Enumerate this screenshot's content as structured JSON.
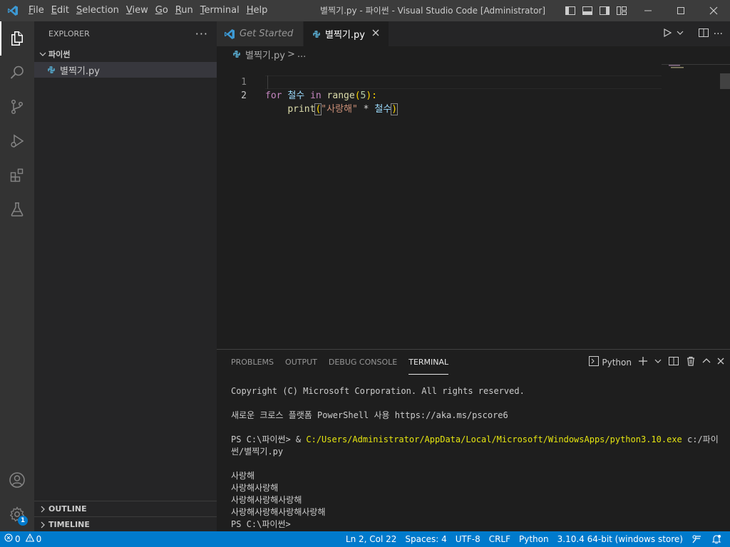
{
  "window": {
    "title": "별찍기.py - 파이썬 - Visual Studio Code [Administrator]",
    "menu": [
      {
        "mn": "F",
        "rest": "ile"
      },
      {
        "mn": "E",
        "rest": "dit"
      },
      {
        "mn": "S",
        "rest": "election"
      },
      {
        "mn": "V",
        "rest": "iew"
      },
      {
        "mn": "G",
        "rest": "o"
      },
      {
        "mn": "R",
        "rest": "un"
      },
      {
        "mn": "T",
        "rest": "erminal"
      },
      {
        "mn": "H",
        "rest": "elp"
      }
    ]
  },
  "sidebar": {
    "title": "EXPLORER",
    "more": "···",
    "folder": "파이썬",
    "files": [
      "별찍기.py"
    ],
    "sections": [
      "OUTLINE",
      "TIMELINE"
    ]
  },
  "activity": {
    "settings_badge": "1"
  },
  "editor": {
    "tabs": [
      {
        "label": "Get Started",
        "active": false
      },
      {
        "label": "별찍기.py",
        "active": true
      }
    ],
    "breadcrumb": {
      "file": "별찍기.py",
      "sep": ">",
      "more": "..."
    },
    "lines": [
      {
        "n": "1",
        "tokens": {
          "kw1": "for",
          "var1": "철수",
          "kw2": "in",
          "fn1": "range",
          "p1": "(",
          "num": "5",
          "p2": "):"
        }
      },
      {
        "n": "2",
        "tokens": {
          "fn": "print",
          "b1": "(",
          "str": "\"사랑해\"",
          "op": " * ",
          "var": "철수",
          "b2": ")"
        }
      }
    ]
  },
  "panel": {
    "tabs": [
      "PROBLEMS",
      "OUTPUT",
      "DEBUG CONSOLE",
      "TERMINAL"
    ],
    "active_tab": "TERMINAL",
    "terminal_name": "Python",
    "terminal": {
      "copyright": "Copyright (C) Microsoft Corporation. All rights reserved.",
      "pwsh": "새로운 크로스 플랫폼 PowerShell 사용 https://aka.ms/pscore6",
      "prompt1": "PS C:\\파이썬> ",
      "amp": "& ",
      "exe": "C:/Users/Administrator/AppData/Local/Microsoft/WindowsApps/python3.10.exe",
      "arg1": " c:/파이",
      "arg2": "썬/별찍기.py",
      "out": [
        "사랑해",
        "사랑해사랑해",
        "사랑해사랑해사랑해",
        "사랑해사랑해사랑해사랑해"
      ],
      "prompt2": "PS C:\\파이썬> "
    }
  },
  "status": {
    "errors": "0",
    "warnings": "0",
    "position": "Ln 2, Col 22",
    "spaces": "Spaces: 4",
    "encoding": "UTF-8",
    "eol": "CRLF",
    "language": "Python",
    "interpreter": "3.10.4 64-bit (windows store)"
  },
  "colors": {
    "accent": "#007acc",
    "keyword": "#c586c0",
    "function": "#dcdcaa",
    "variable": "#9cdcfe",
    "string": "#ce9178",
    "number": "#b5cea8"
  }
}
